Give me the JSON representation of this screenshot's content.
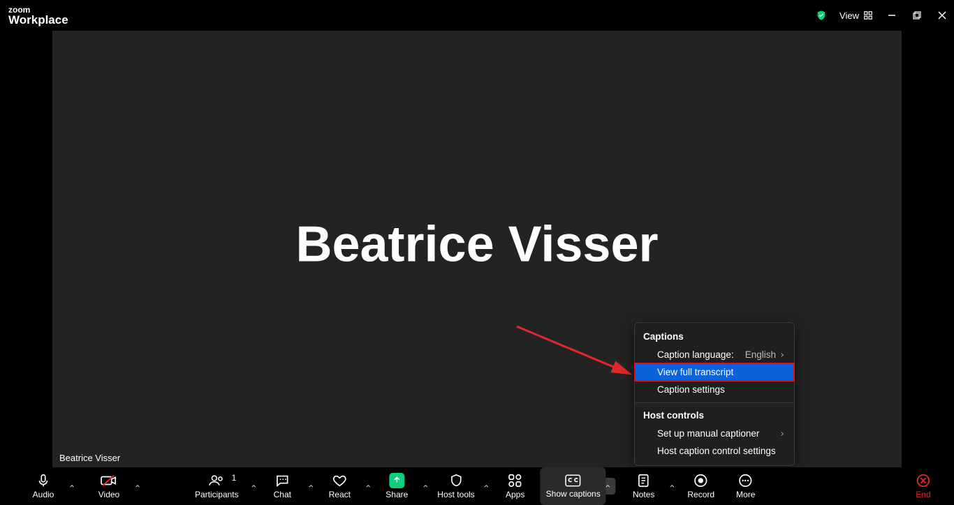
{
  "titlebar": {
    "logo_top": "zoom",
    "logo_bottom": "Workplace",
    "view_label": "View"
  },
  "main": {
    "participant_display_name": "Beatrice Visser",
    "nametag": "Beatrice Visser"
  },
  "popup": {
    "section1_title": "Captions",
    "caption_language_label": "Caption language:",
    "caption_language_value": "English",
    "view_full_transcript": "View full transcript",
    "caption_settings": "Caption settings",
    "section2_title": "Host controls",
    "set_up_manual": "Set up manual captioner",
    "host_caption_control": "Host caption control settings"
  },
  "toolbar": {
    "audio": "Audio",
    "video": "Video",
    "participants": "Participants",
    "participants_count": "1",
    "chat": "Chat",
    "react": "React",
    "share": "Share",
    "host_tools": "Host tools",
    "apps": "Apps",
    "show_captions": "Show captions",
    "notes": "Notes",
    "record": "Record",
    "more": "More",
    "end": "End"
  }
}
